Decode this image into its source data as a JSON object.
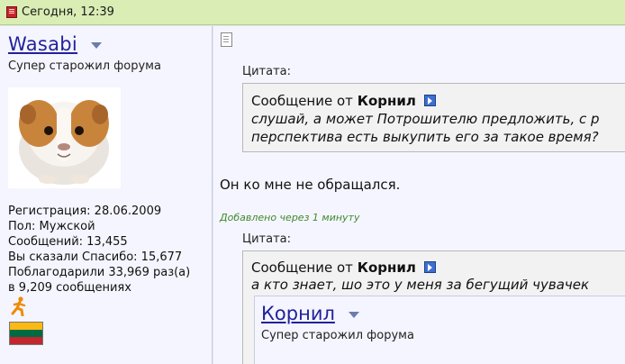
{
  "header": {
    "date": "Сегодня, 12:39"
  },
  "user": {
    "name": "Wasabi",
    "title": "Супер старожил форума",
    "stats": [
      "Регистрация: 28.06.2009",
      "Пол: Мужской",
      "Сообщений: 13,455",
      "Вы сказали Спасибо: 15,677",
      "Поблагодарили 33,969 раз(а)",
      "в 9,209 сообщениях"
    ],
    "flag_colors": [
      "#fdb913",
      "#006a44",
      "#c1272d"
    ]
  },
  "post": {
    "quote1": {
      "label": "Цитата:",
      "prefix": "Сообщение от",
      "author": "Корнил",
      "lines": [
        "слушай, а может Потрошителю предложить, с р",
        "перспектива есть выкупить его за такое время?"
      ]
    },
    "text": "Он ко мне не обращался.",
    "added_note": "Добавлено через 1 минуту",
    "quote2": {
      "label": "Цитата:",
      "prefix": "Сообщение от",
      "author": "Корнил",
      "line": "а кто знает, шо это у меня за бегущий чувачек",
      "nested": {
        "name": "Корнил",
        "title": "Супер старожил форума"
      }
    }
  }
}
